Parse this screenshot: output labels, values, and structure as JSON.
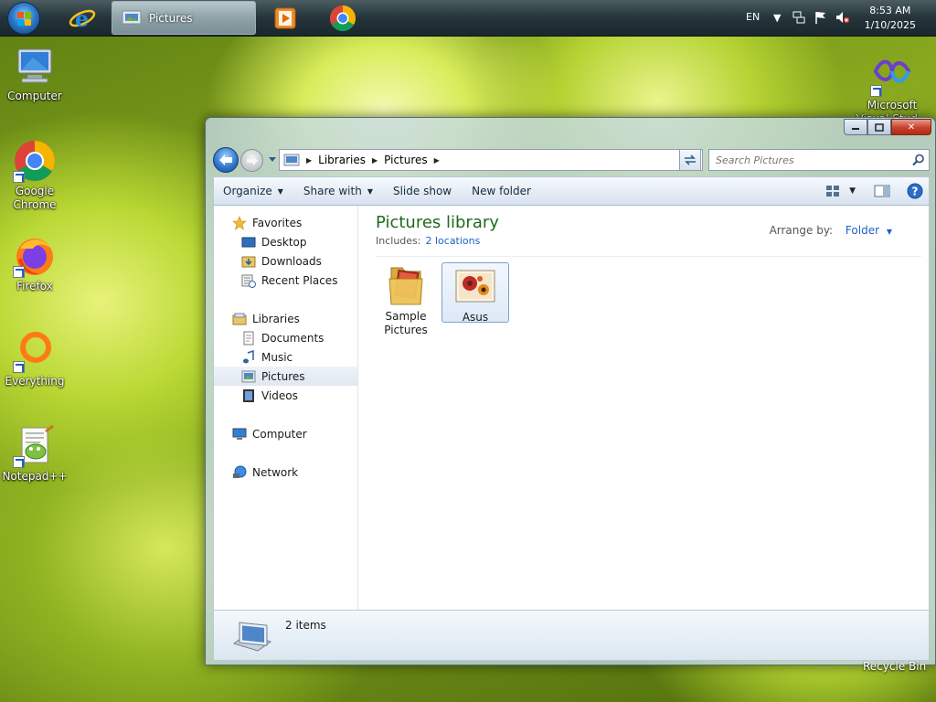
{
  "taskbar": {
    "active_task": "Pictures",
    "language": "EN",
    "time": "8:53 AM",
    "date": "1/10/2025"
  },
  "desktop": {
    "icons": [
      {
        "label": "Computer",
        "icon": "computer-icon"
      },
      {
        "label": "Google Chrome",
        "icon": "chrome-icon"
      },
      {
        "label": "Firefox",
        "icon": "firefox-icon"
      },
      {
        "label": "Everything",
        "icon": "everything-icon"
      },
      {
        "label": "Notepad++",
        "icon": "notepadpp-icon"
      },
      {
        "label": "Microsoft Visual Stud...",
        "icon": "visual-studio-icon"
      }
    ],
    "recycle_bin": "Recycle Bin"
  },
  "window": {
    "breadcrumb": [
      "Libraries",
      "Pictures"
    ],
    "search_placeholder": "Search Pictures",
    "toolbar": {
      "organize": "Organize",
      "share_with": "Share with",
      "slide_show": "Slide show",
      "new_folder": "New folder"
    },
    "nav": {
      "favorites": "Favorites",
      "desktop": "Desktop",
      "downloads": "Downloads",
      "recent_places": "Recent Places",
      "libraries": "Libraries",
      "documents": "Documents",
      "music": "Music",
      "pictures": "Pictures",
      "videos": "Videos",
      "computer": "Computer",
      "network": "Network"
    },
    "main": {
      "title": "Pictures library",
      "includes_label": "Includes:",
      "includes_link": "2 locations",
      "arrange_label": "Arrange by:",
      "arrange_value": "Folder",
      "items": [
        {
          "label": "Sample Pictures",
          "icon": "folder-icon"
        },
        {
          "label": "Asus",
          "icon": "image-file-icon"
        }
      ]
    },
    "details": {
      "count": "2 items"
    }
  },
  "colors": {
    "title_green": "#1e6b1e",
    "link_blue": "#1c62c7",
    "taskbar": "#24343a"
  }
}
